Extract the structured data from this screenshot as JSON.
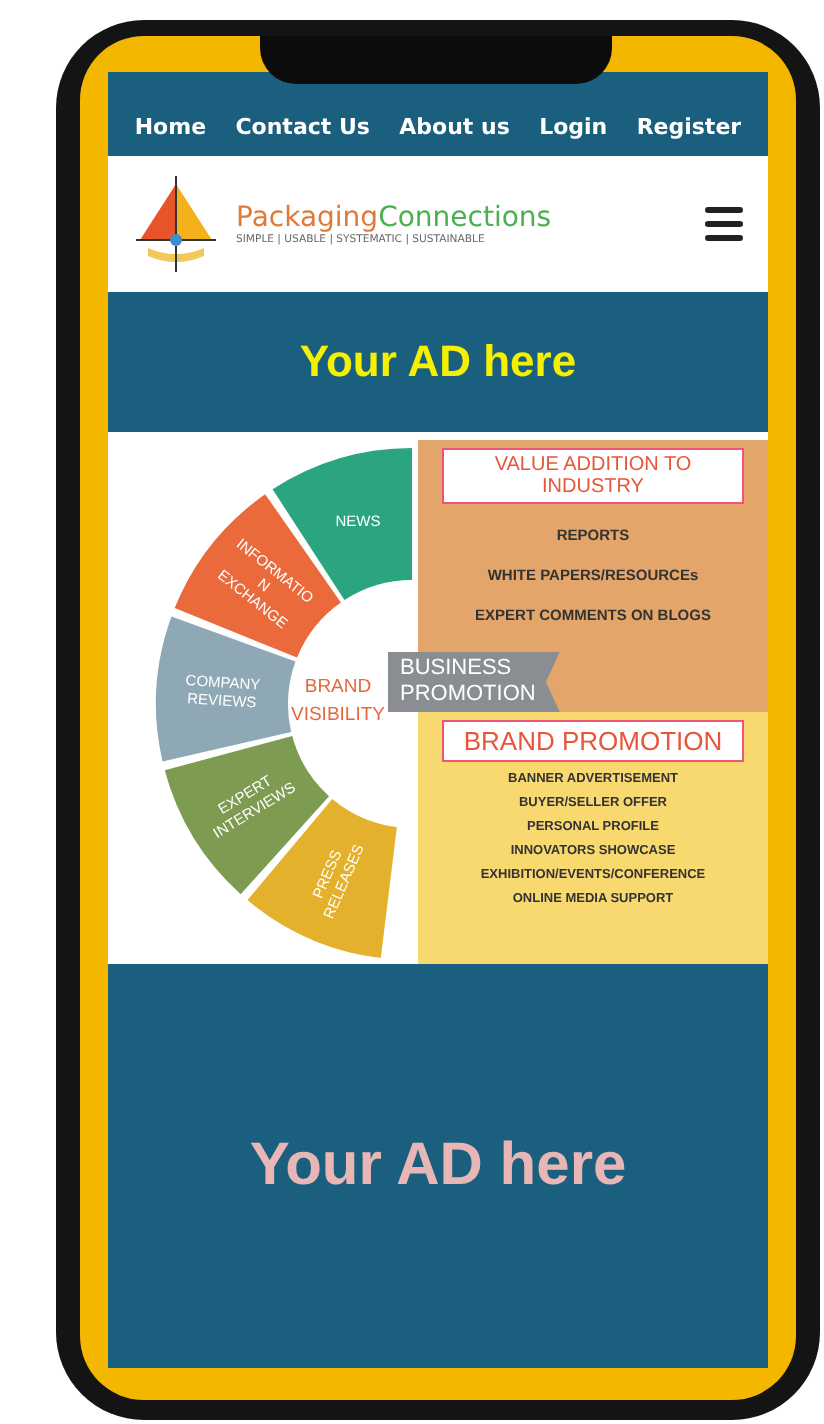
{
  "nav": [
    {
      "label": "Home"
    },
    {
      "label": "Contact Us"
    },
    {
      "label": "About us"
    },
    {
      "label": "Login"
    },
    {
      "label": "Register"
    }
  ],
  "logo": {
    "name_first": "Packaging",
    "name_second": "Connections",
    "tagline": "SIMPLE | USABLE | SYSTEMATIC | SUSTAINABLE"
  },
  "top_ad": "Your AD here",
  "infographic": {
    "segments": [
      {
        "lines": [
          "NEWS"
        ],
        "color": "#2ba57f"
      },
      {
        "lines": [
          "INFORMATIO",
          "N",
          "EXCHANGE"
        ],
        "color": "#ea6a3c"
      },
      {
        "lines": [
          "COMPANY",
          "REVIEWS"
        ],
        "color": "#8fa8b6"
      },
      {
        "lines": [
          "EXPERT",
          "INTERVIEWS"
        ],
        "color": "#7e9b52"
      },
      {
        "lines": [
          "PRESS",
          "RELEASES"
        ],
        "color": "#e3b12c"
      }
    ],
    "center": [
      "BRAND",
      "VISIBILITY"
    ],
    "ribbon": [
      "BUSINESS",
      "PROMOTION"
    ],
    "panels": [
      {
        "kind": "orange",
        "title": "VALUE ADDITION TO INDUSTRY",
        "items": [
          "REPORTS",
          "WHITE PAPERS/RESOURCEs",
          "EXPERT COMMENTS ON BLOGS"
        ]
      },
      {
        "kind": "yellow",
        "title": "BRAND PROMOTION",
        "items": [
          "BANNER ADVERTISEMENT",
          "BUYER/SELLER OFFER",
          "PERSONAL PROFILE",
          "INNOVATORS SHOWCASE",
          "EXHIBITION/EVENTS/CONFERENCE",
          "ONLINE MEDIA SUPPORT"
        ]
      }
    ]
  },
  "bottom_ad": "Your AD here"
}
